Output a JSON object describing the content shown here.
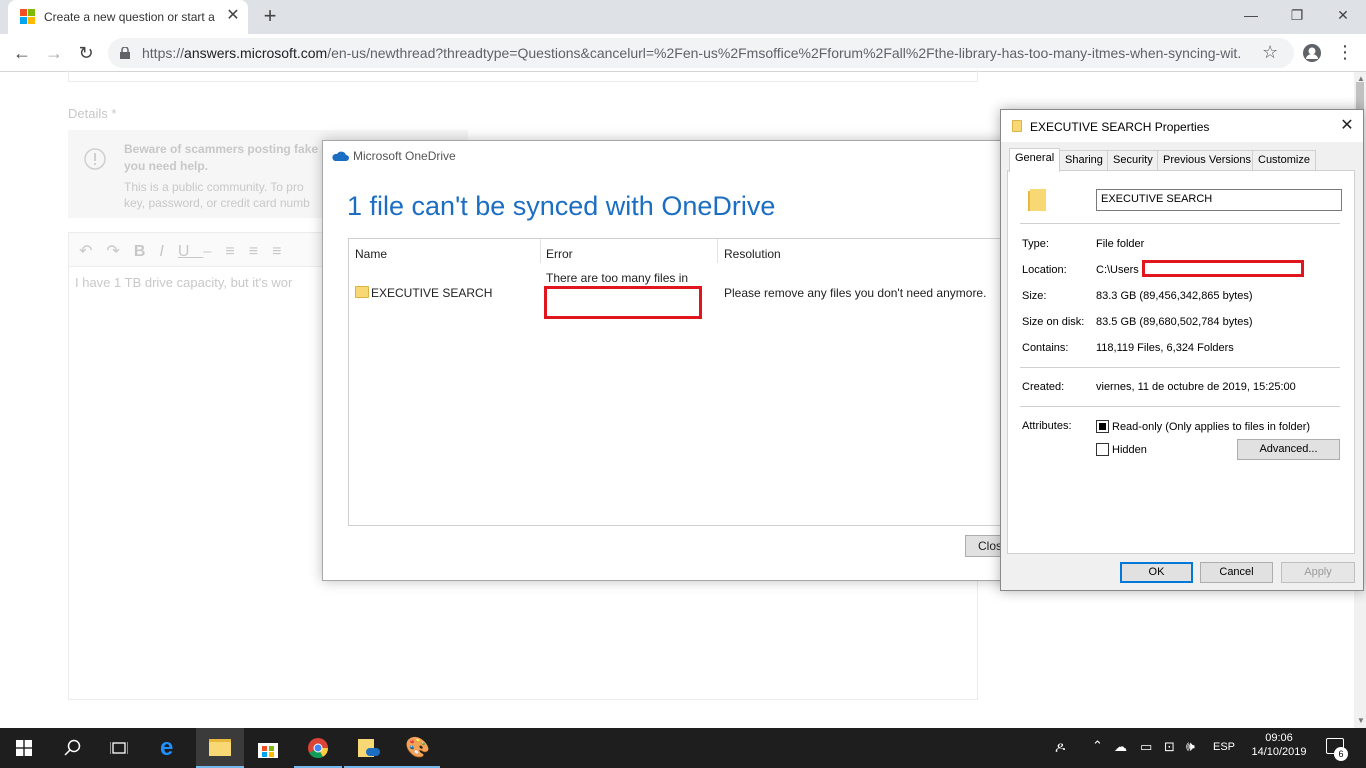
{
  "browser": {
    "tab_title": "Create a new question or start a",
    "url_prefix": "https://",
    "url_domain": "answers.microsoft.com",
    "url_rest": "/en-us/newthread?threadtype=Questions&cancelurl=%2Fen-us%2Fmsoffice%2Fforum%2Fall%2Fthe-library-has-too-many-itmes-when-syncing-wit..."
  },
  "page": {
    "details_label": "Details *",
    "warning_title": "Beware of scammers posting fake",
    "warning_title2": "you need help.",
    "warning_body": "This is a public community. To pro",
    "warning_body2": "key, password, or credit card numb",
    "editor_text": "I have 1 TB drive capacity, but it's wor"
  },
  "onedrive": {
    "title": "Microsoft OneDrive",
    "heading": "1 file can't be synced with OneDrive",
    "columns": {
      "name": "Name",
      "error": "Error",
      "resolution": "Resolution"
    },
    "row": {
      "name": "EXECUTIVE SEARCH",
      "error": "There are too many files in",
      "resolution": "Please remove any files you don't need anymore."
    },
    "close_label": "Close"
  },
  "properties": {
    "title": "EXECUTIVE SEARCH Properties",
    "tabs": [
      "General",
      "Sharing",
      "Security",
      "Previous Versions",
      "Customize"
    ],
    "folder_name": "EXECUTIVE SEARCH",
    "type_label": "Type:",
    "type_value": "File folder",
    "location_label": "Location:",
    "location_value": "C:\\Users",
    "size_label": "Size:",
    "size_value": "83.3 GB (89,456,342,865 bytes)",
    "size_on_disk_label": "Size on disk:",
    "size_on_disk_value": "83.5 GB (89,680,502,784 bytes)",
    "contains_label": "Contains:",
    "contains_value": "118,119 Files, 6,324 Folders",
    "created_label": "Created:",
    "created_value": "viernes, 11 de octubre de 2019, 15:25:00",
    "attributes_label": "Attributes:",
    "readonly_label": "Read-only (Only applies to files in folder)",
    "hidden_label": "Hidden",
    "advanced_label": "Advanced...",
    "ok_label": "OK",
    "cancel_label": "Cancel",
    "apply_label": "Apply"
  },
  "taskbar": {
    "language": "ESP",
    "time": "09:06",
    "date": "14/10/2019",
    "notifications": "6"
  },
  "colors": {
    "onedrive_blue": "#1c6ec2",
    "redaction_red": "#e0151d",
    "taskbar": "#1e1e1e"
  }
}
